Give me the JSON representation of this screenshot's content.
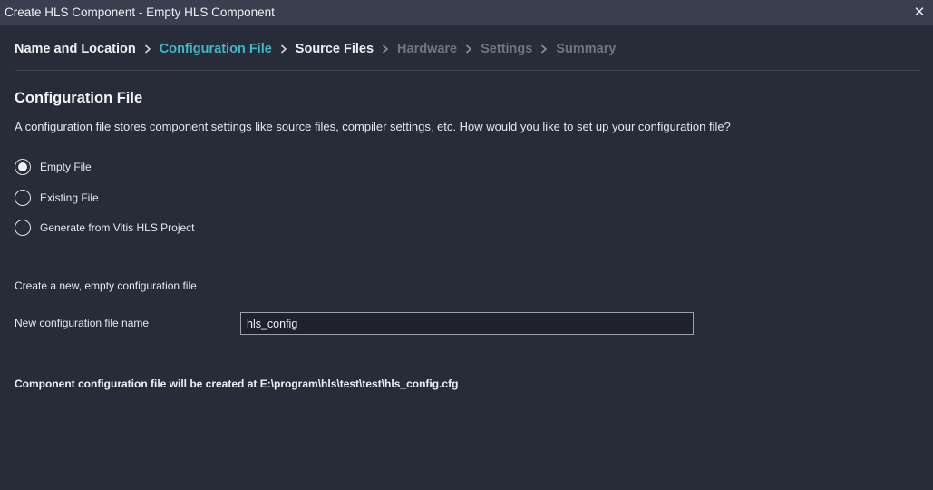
{
  "window": {
    "title": "Create HLS Component - Empty HLS Component",
    "close_icon": "close-icon"
  },
  "wizard": {
    "steps": [
      {
        "label": "Name and Location",
        "state": "done"
      },
      {
        "label": "Configuration File",
        "state": "active"
      },
      {
        "label": "Source Files",
        "state": "done"
      },
      {
        "label": "Hardware",
        "state": "pending"
      },
      {
        "label": "Settings",
        "state": "pending"
      },
      {
        "label": "Summary",
        "state": "pending"
      }
    ],
    "colors": {
      "active": "#3fb8c7",
      "pending": "#6e7485",
      "done": "#eef0f4"
    }
  },
  "config": {
    "title": "Configuration File",
    "description": "A configuration file stores component settings like source files, compiler settings, etc. How would you like to set up your configuration file?",
    "options": [
      {
        "label": "Empty File",
        "selected": true
      },
      {
        "label": "Existing File",
        "selected": false
      },
      {
        "label": "Generate from Vitis HLS Project",
        "selected": false
      }
    ],
    "option_hint": "Create a new, empty configuration file",
    "filename_label": "New configuration file name",
    "filename_value": "hls_config",
    "path_note": "Component configuration file will be created at E:\\program\\hls\\test\\test\\hls_config.cfg"
  }
}
